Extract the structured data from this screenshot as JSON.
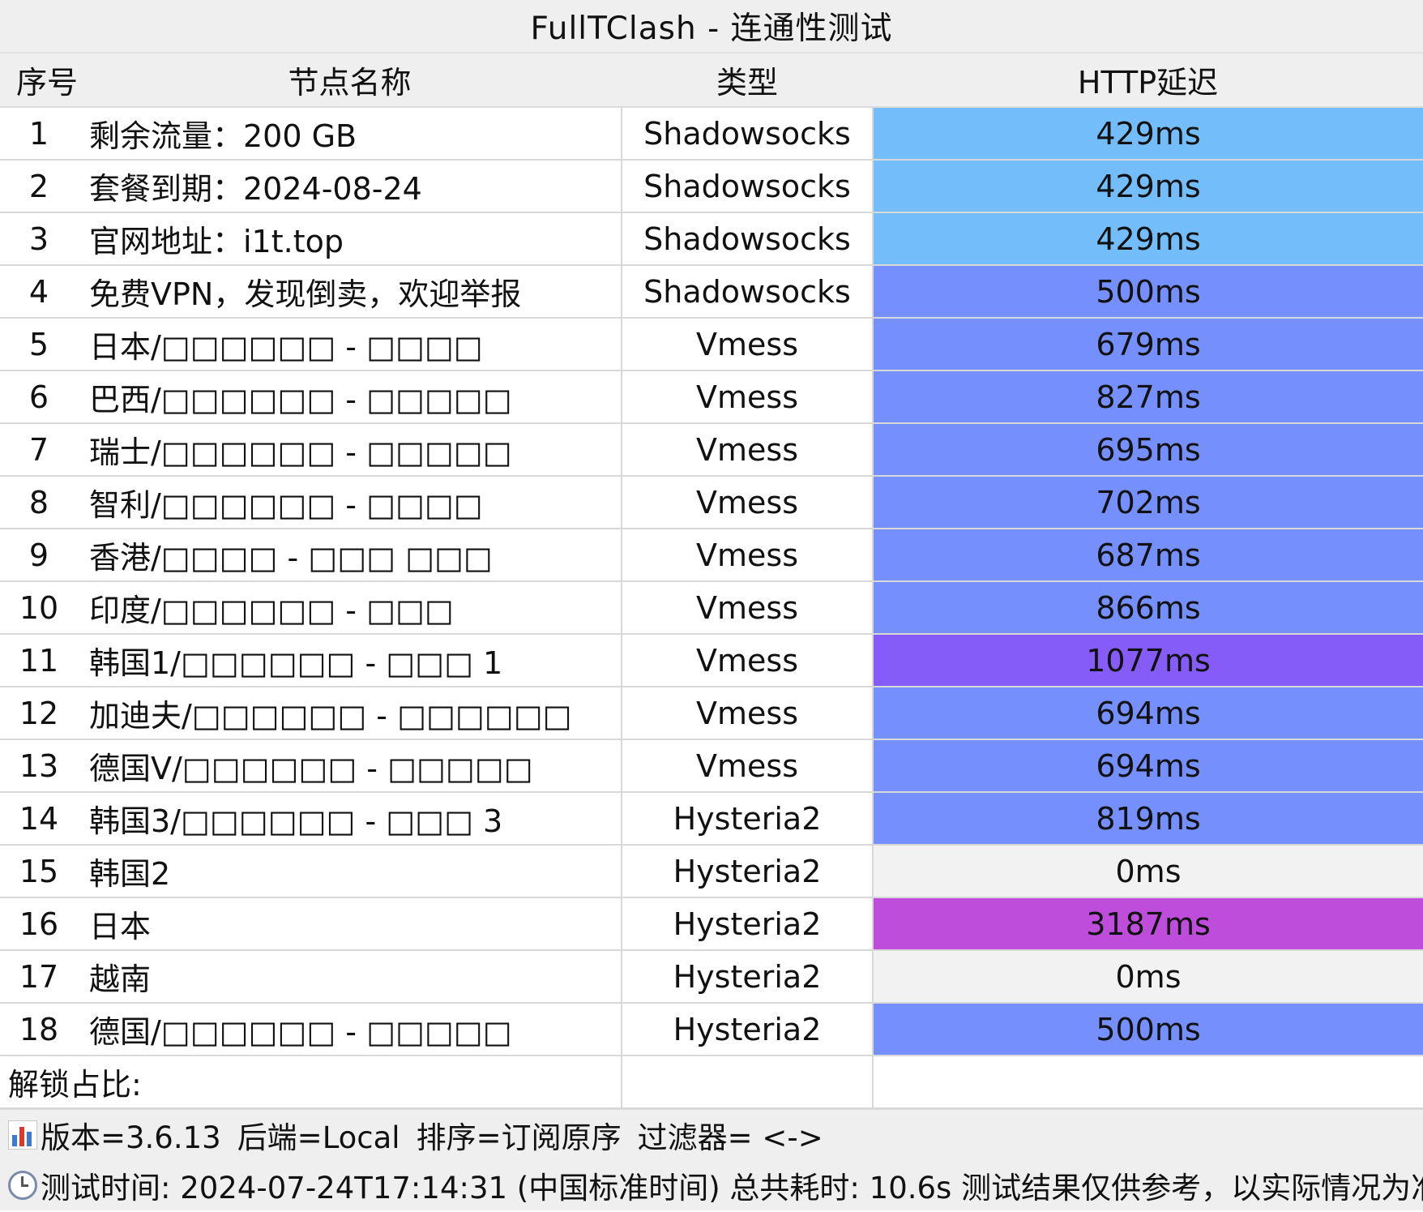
{
  "title": "FullTClash - 连通性测试",
  "columns": {
    "index": "序号",
    "name": "节点名称",
    "type": "类型",
    "latency": "HTTP延迟"
  },
  "rows": [
    {
      "index": "1",
      "name": "剩余流量：200 GB",
      "type": "Shadowsocks",
      "latency": "429ms",
      "color": "#74bdfb"
    },
    {
      "index": "2",
      "name": "套餐到期：2024-08-24",
      "type": "Shadowsocks",
      "latency": "429ms",
      "color": "#74bdfb"
    },
    {
      "index": "3",
      "name": "官网地址：i1t.top",
      "type": "Shadowsocks",
      "latency": "429ms",
      "color": "#74bdfb"
    },
    {
      "index": "4",
      "name": "免费VPN，发现倒卖，欢迎举报",
      "type": "Shadowsocks",
      "latency": "500ms",
      "color": "#758ffd"
    },
    {
      "index": "5",
      "name": "日本/□□□□□□ - □□□□",
      "type": "Vmess",
      "latency": "679ms",
      "color": "#758ffd"
    },
    {
      "index": "6",
      "name": "巴西/□□□□□□ - □□□□□",
      "type": "Vmess",
      "latency": "827ms",
      "color": "#758ffd"
    },
    {
      "index": "7",
      "name": "瑞士/□□□□□□ - □□□□□",
      "type": "Vmess",
      "latency": "695ms",
      "color": "#758ffd"
    },
    {
      "index": "8",
      "name": "智利/□□□□□□ - □□□□",
      "type": "Vmess",
      "latency": "702ms",
      "color": "#758ffd"
    },
    {
      "index": "9",
      "name": "香港/□□□□ - □□□ □□□",
      "type": "Vmess",
      "latency": "687ms",
      "color": "#758ffd"
    },
    {
      "index": "10",
      "name": "印度/□□□□□□ - □□□",
      "type": "Vmess",
      "latency": "866ms",
      "color": "#758ffd"
    },
    {
      "index": "11",
      "name": "韩国1/□□□□□□ - □□□ 1",
      "type": "Vmess",
      "latency": "1077ms",
      "color": "#865cf8"
    },
    {
      "index": "12",
      "name": "加迪夫/□□□□□□ - □□□□□□",
      "type": "Vmess",
      "latency": "694ms",
      "color": "#758ffd"
    },
    {
      "index": "13",
      "name": "德国V/□□□□□□ - □□□□□",
      "type": "Vmess",
      "latency": "694ms",
      "color": "#758ffd"
    },
    {
      "index": "14",
      "name": "韩国3/□□□□□□ - □□□ 3",
      "type": "Hysteria2",
      "latency": "819ms",
      "color": "#758ffd"
    },
    {
      "index": "15",
      "name": "韩国2",
      "type": "Hysteria2",
      "latency": "0ms",
      "color": "#f3f2f2"
    },
    {
      "index": "16",
      "name": "日本",
      "type": "Hysteria2",
      "latency": "3187ms",
      "color": "#be4ddc"
    },
    {
      "index": "17",
      "name": "越南",
      "type": "Hysteria2",
      "latency": "0ms",
      "color": "#f3f2f2"
    },
    {
      "index": "18",
      "name": "德国/□□□□□□ - □□□□□",
      "type": "Hysteria2",
      "latency": "500ms",
      "color": "#758ffd"
    }
  ],
  "unlock_label": "解锁占比:",
  "footer": {
    "version": "版本=3.6.13",
    "backend": "后端=Local",
    "sort": "排序=订阅原序",
    "filter": "过滤器= <->",
    "test_info": "测试时间: 2024-07-24T17:14:31 (中国标准时间) 总共耗时: 10.6s 测试结果仅供参考，以实际情况为准",
    "icons": [
      "bar-chart-icon",
      "clock-icon"
    ]
  }
}
